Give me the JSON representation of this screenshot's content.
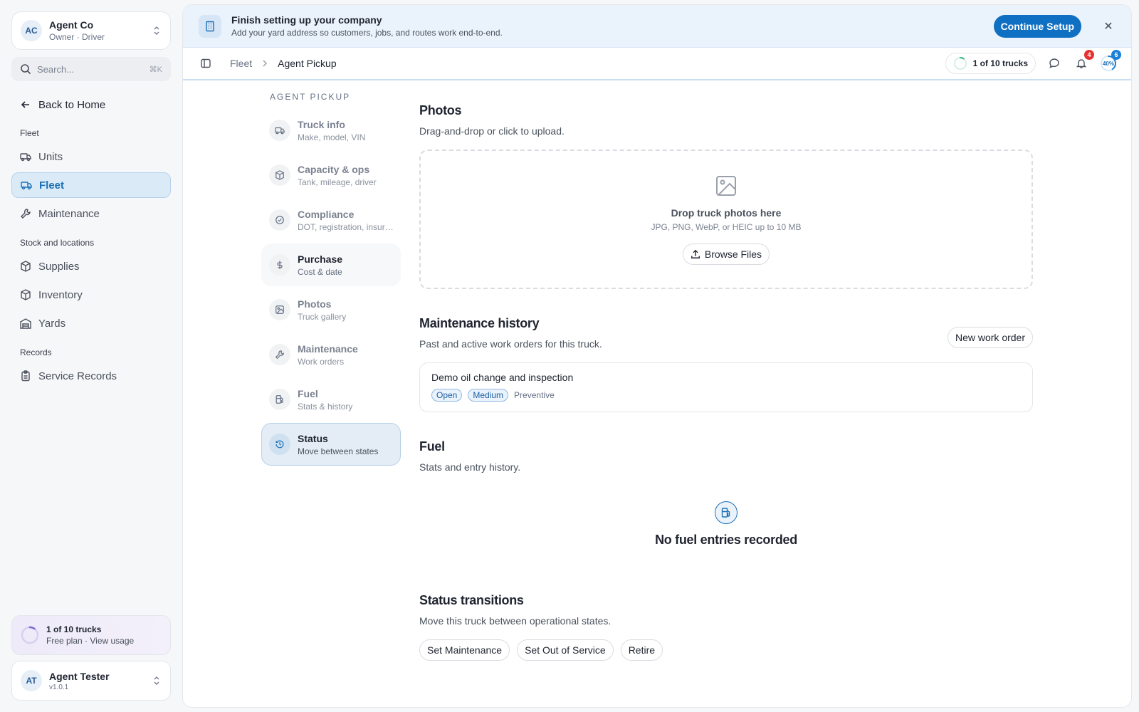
{
  "org": {
    "initials": "AC",
    "name": "Agent Co",
    "role": "Owner · Driver"
  },
  "search": {
    "placeholder": "Search...",
    "shortcut": "⌘K"
  },
  "back_label": "Back to Home",
  "sidebar": {
    "sections": [
      {
        "title": "Fleet",
        "items": [
          {
            "label": "Units",
            "active": false
          },
          {
            "label": "Fleet",
            "active": true
          },
          {
            "label": "Maintenance",
            "active": false
          }
        ]
      },
      {
        "title": "Stock and locations",
        "items": [
          {
            "label": "Supplies"
          },
          {
            "label": "Inventory"
          },
          {
            "label": "Yards"
          }
        ]
      },
      {
        "title": "Records",
        "items": [
          {
            "label": "Service Records"
          }
        ]
      }
    ]
  },
  "usage": {
    "title": "1 of 10 trucks",
    "subtitle": "Free plan · View usage",
    "progress": 0.1
  },
  "user": {
    "initials": "AT",
    "name": "Agent Tester",
    "version": "v1.0.1"
  },
  "banner": {
    "title": "Finish setting up your company",
    "subtitle": "Add your yard address so customers, jobs, and routes work end-to-end.",
    "button": "Continue Setup"
  },
  "breadcrumb": {
    "parent": "Fleet",
    "current": "Agent Pickup"
  },
  "topbar": {
    "trucks_pill": "1 of 10 trucks",
    "notifications": "4",
    "onboarding_count": "6",
    "onboarding_percent": "40%"
  },
  "subnav": {
    "heading": "AGENT PICKUP",
    "items": [
      {
        "title": "Truck info",
        "subtitle": "Make, model, VIN",
        "icon": "truck-icon"
      },
      {
        "title": "Capacity & ops",
        "subtitle": "Tank, mileage, driver",
        "icon": "box-icon"
      },
      {
        "title": "Compliance",
        "subtitle": "DOT, registration, insurance",
        "icon": "check-circle-icon"
      },
      {
        "title": "Purchase",
        "subtitle": "Cost & date",
        "icon": "dollar-icon"
      },
      {
        "title": "Photos",
        "subtitle": "Truck gallery",
        "icon": "image-icon"
      },
      {
        "title": "Maintenance",
        "subtitle": "Work orders",
        "icon": "wrench-icon"
      },
      {
        "title": "Fuel",
        "subtitle": "Stats & history",
        "icon": "fuel-icon"
      },
      {
        "title": "Status",
        "subtitle": "Move between states",
        "icon": "history-icon"
      }
    ]
  },
  "photos": {
    "title": "Photos",
    "description": "Drag-and-drop or click to upload.",
    "drop_title": "Drop truck photos here",
    "drop_hint": "JPG, PNG, WebP, or HEIC up to 10 MB",
    "browse_button": "Browse Files"
  },
  "maintenance": {
    "title": "Maintenance history",
    "description": "Past and active work orders for this truck.",
    "new_button": "New work order",
    "orders": [
      {
        "title": "Demo oil change and inspection",
        "status": "Open",
        "priority": "Medium",
        "type": "Preventive"
      }
    ]
  },
  "fuel": {
    "title": "Fuel",
    "description": "Stats and entry history.",
    "empty": "No fuel entries recorded"
  },
  "status": {
    "title": "Status transitions",
    "description": "Move this truck between operational states.",
    "buttons": [
      "Set Maintenance",
      "Set Out of Service",
      "Retire"
    ]
  },
  "colors": {
    "accent": "#0f6fc2",
    "active_nav_bg": "#dbeaf7",
    "badge_red": "#e5312f",
    "tag_blue": "#1b5fa5"
  }
}
